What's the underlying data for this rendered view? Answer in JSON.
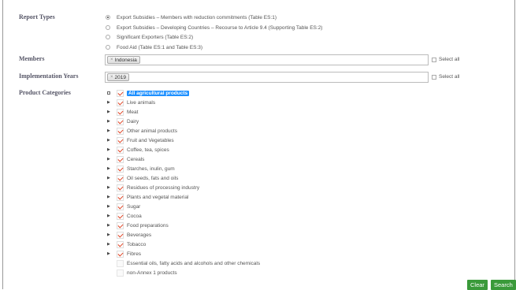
{
  "labels": {
    "report_types": "Report Types",
    "members": "Members",
    "implementation_years": "Implementation Years",
    "product_categories": "Product Categories"
  },
  "report_types": [
    {
      "label": "Export Subsidies – Members with reduction commitments (Table ES:1)",
      "selected": true
    },
    {
      "label": "Export Subsidies – Developing Countries – Recourse to Article 9.4 (Supporting Table ES:2)",
      "selected": false
    },
    {
      "label": "Significant Exporters (Table ES:2)",
      "selected": false
    },
    {
      "label": "Food Aid (Table ES:1 and Table ES:3)",
      "selected": false
    }
  ],
  "members": {
    "token": "Indonesia",
    "select_all": "Select all"
  },
  "years": {
    "token": "2019",
    "select_all": "Select all"
  },
  "tree": {
    "root": "All agricultural products",
    "items": [
      "Live animals",
      "Meat",
      "Dairy",
      "Other animal products",
      "Fruit and Vegetables",
      "Coffee, tea, spices",
      "Cereals",
      "Starches, inulin, gum",
      "Oil seeds, fats and oils",
      "Residues of processing industry",
      "Plants and vegetal material",
      "Sugar",
      "Cocoa",
      "Food preparations",
      "Beverages",
      "Tobacco",
      "Fibres"
    ],
    "leaf_items": [
      "Essential oils, fatty acids and alcohols and other chemicals",
      "non-Annex 1 products"
    ]
  },
  "buttons": {
    "clear": "Clear",
    "search": "Search"
  },
  "colors": {
    "highlight": "#1e90ff",
    "check": "#e04020",
    "button": "#3a9a3a"
  }
}
